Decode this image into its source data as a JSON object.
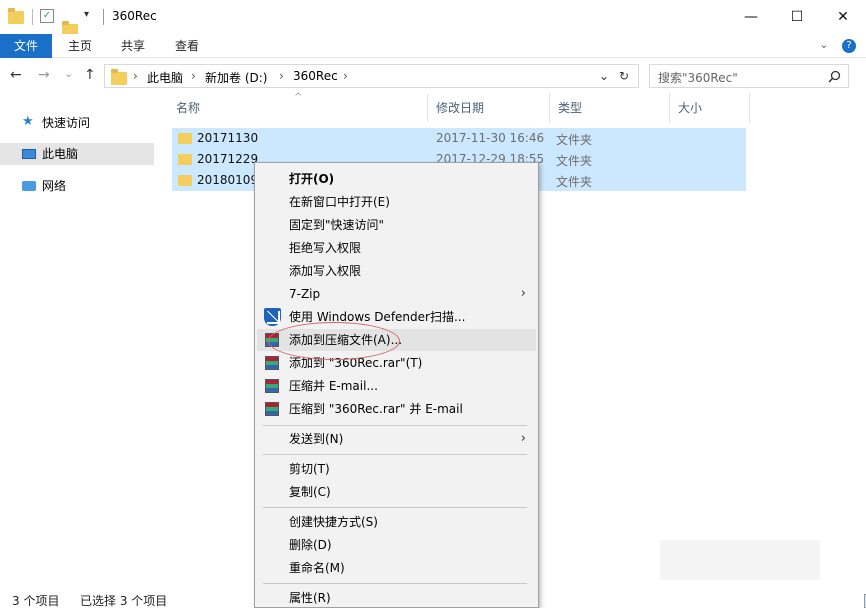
{
  "window": {
    "title": "360Rec",
    "minimize": "—",
    "maximize": "☐",
    "close": "✕"
  },
  "ribbon": {
    "tabs": [
      "文件",
      "主页",
      "共享",
      "查看"
    ],
    "collapse": "⌄",
    "help": "?"
  },
  "nav": {
    "back": "←",
    "forward": "→",
    "recent": "⌄",
    "up": "↑"
  },
  "address": {
    "segments": [
      "此电脑",
      "新加卷 (D:)",
      "360Rec"
    ],
    "sep": "›",
    "dropdown": "⌄",
    "refresh": "↻"
  },
  "search": {
    "placeholder": "搜索\"360Rec\"",
    "icon": "search-icon"
  },
  "navpane": {
    "items": [
      {
        "label": "快速访问",
        "icon": "star-icon",
        "selected": false
      },
      {
        "label": "此电脑",
        "icon": "computer-icon",
        "selected": true
      },
      {
        "label": "网络",
        "icon": "network-icon",
        "selected": false
      }
    ]
  },
  "columns": [
    "名称",
    "修改日期",
    "类型",
    "大小"
  ],
  "sort_indicator": "^",
  "rows": [
    {
      "name": "20171130",
      "date": "2017-11-30 16:46",
      "type": "文件夹"
    },
    {
      "name": "20171229",
      "date": "2017-12-29 18:55",
      "type": "文件夹"
    },
    {
      "name": "20180109",
      "date": "",
      "type": "文件夹"
    }
  ],
  "status": {
    "count": "3 个项目",
    "selected": "已选择 3 个项目"
  },
  "context_menu": {
    "items": [
      {
        "label": "打开(O)",
        "bold": true
      },
      {
        "label": "在新窗口中打开(E)"
      },
      {
        "label": "固定到\"快速访问\""
      },
      {
        "label": "拒绝写入权限"
      },
      {
        "label": "添加写入权限"
      },
      {
        "label": "7-Zip",
        "submenu": true
      },
      {
        "label": "使用 Windows Defender扫描...",
        "icon": "shield-icon"
      },
      {
        "label": "添加到压缩文件(A)...",
        "icon": "winrar-icon",
        "highlighted": true
      },
      {
        "label": "添加到 \"360Rec.rar\"(T)",
        "icon": "winrar-icon"
      },
      {
        "label": "压缩并 E-mail...",
        "icon": "winrar-icon"
      },
      {
        "label": "压缩到 \"360Rec.rar\" 并 E-mail",
        "icon": "winrar-icon"
      },
      {
        "label": "发送到(N)",
        "submenu": true
      },
      {
        "label": "剪切(T)"
      },
      {
        "label": "复制(C)"
      },
      {
        "label": "创建快捷方式(S)"
      },
      {
        "label": "删除(D)"
      },
      {
        "label": "重命名(M)"
      },
      {
        "label": "属性(R)"
      }
    ],
    "submenu_arrow": "›"
  },
  "colors": {
    "file_tab": "#1a6fc9",
    "selection": "#cce8ff",
    "menu_bg": "#f2f2f2",
    "annotation": "#d2666b"
  }
}
